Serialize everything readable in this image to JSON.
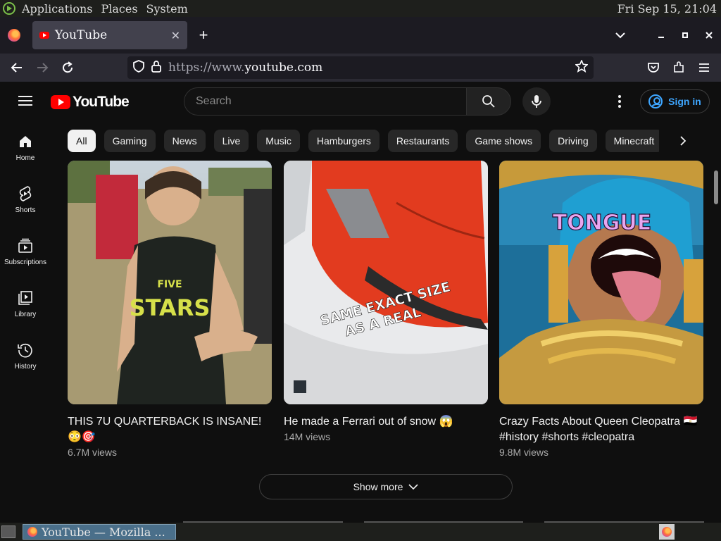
{
  "os": {
    "menu": [
      "Applications",
      "Places",
      "System"
    ],
    "clock": "Fri Sep 15, 21:04"
  },
  "browser": {
    "tab_title": "YouTube",
    "url_scheme": "https://www.",
    "url_host": "youtube.com"
  },
  "yt": {
    "logo_text": "YouTube",
    "search_placeholder": "Search",
    "sign_in": "Sign in",
    "sidebar": [
      {
        "label": "Home",
        "icon": "home-icon"
      },
      {
        "label": "Shorts",
        "icon": "shorts-icon"
      },
      {
        "label": "Subscriptions",
        "icon": "subscriptions-icon"
      },
      {
        "label": "Library",
        "icon": "library-icon"
      },
      {
        "label": "History",
        "icon": "history-icon"
      }
    ],
    "chips": [
      "All",
      "Gaming",
      "News",
      "Live",
      "Music",
      "Hamburgers",
      "Restaurants",
      "Game shows",
      "Driving",
      "Minecraft"
    ],
    "shorts": [
      {
        "title": "THIS 7U QUARTERBACK IS INSANE! 😳🎯",
        "views": "6.7M views"
      },
      {
        "title": "He made a Ferrari out of snow 😱",
        "views": "14M views",
        "overlay": "SAME EXACT SIZE AS A REAL"
      },
      {
        "title": "Crazy Facts About Queen Cleopatra 🇪🇬 #history #shorts #cleopatra",
        "views": "9.8M views",
        "overlay": "TONGUE"
      }
    ],
    "show_more": "Show more"
  },
  "taskbar": {
    "window_title": "YouTube — Mozilla ..."
  },
  "colors": {
    "background": "#0f0f0f",
    "brand_red": "#ff0000",
    "link_blue": "#3ea6ff",
    "chip_bg": "#272727"
  }
}
